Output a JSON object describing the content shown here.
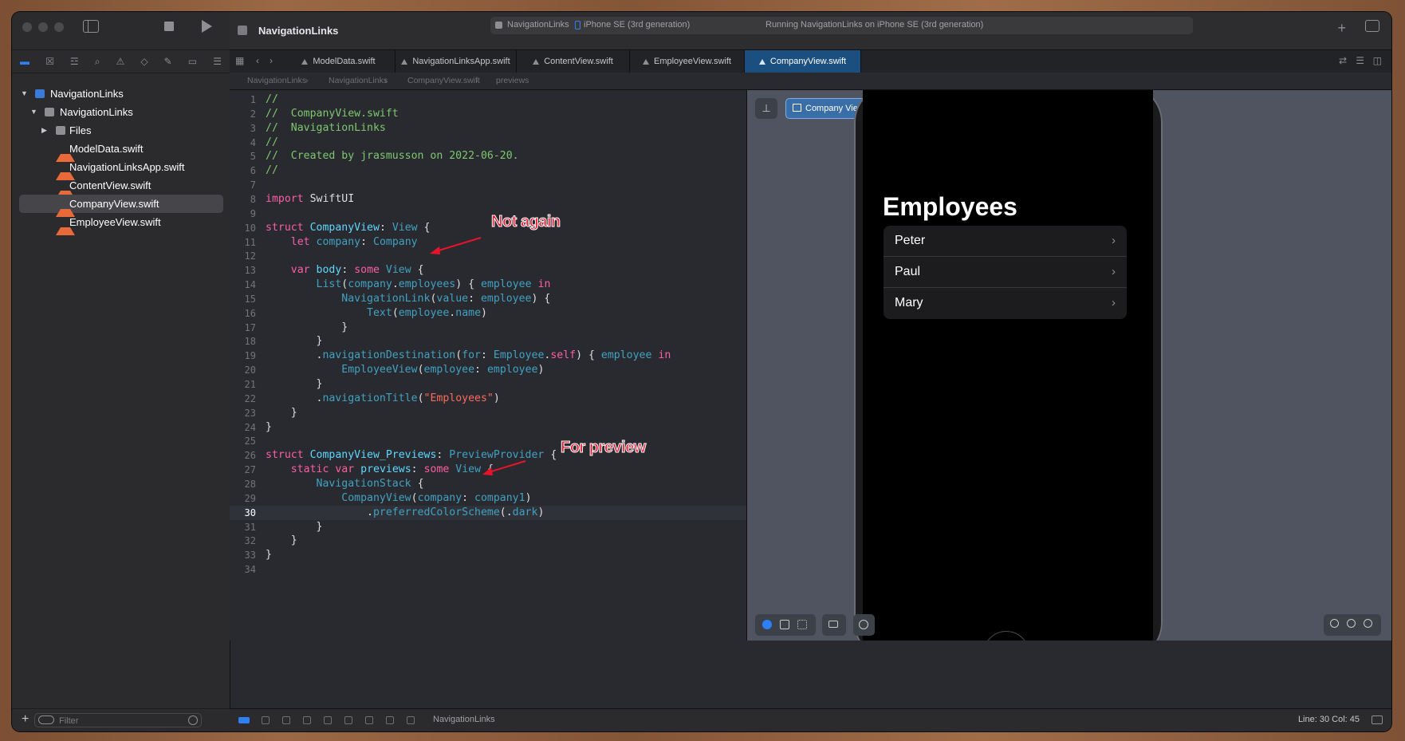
{
  "window": {
    "project_name": "NavigationLinks",
    "scheme": "NavigationLinks",
    "device": "iPhone SE (3rd generation)",
    "run_status": "Running NavigationLinks on iPhone SE (3rd generation)"
  },
  "sidebar": {
    "project": "NavigationLinks",
    "group": "NavigationLinks",
    "items": [
      {
        "label": "Files",
        "kind": "folder"
      },
      {
        "label": "ModelData.swift",
        "kind": "swift"
      },
      {
        "label": "NavigationLinksApp.swift",
        "kind": "swift"
      },
      {
        "label": "ContentView.swift",
        "kind": "swift"
      },
      {
        "label": "CompanyView.swift",
        "kind": "swift",
        "selected": true
      },
      {
        "label": "EmployeeView.swift",
        "kind": "swift"
      }
    ],
    "filter_placeholder": "Filter"
  },
  "tabs": [
    {
      "label": "ModelData.swift"
    },
    {
      "label": "NavigationLinksApp.swift"
    },
    {
      "label": "ContentView.swift"
    },
    {
      "label": "EmployeeView.swift"
    },
    {
      "label": "CompanyView.swift",
      "active": true
    }
  ],
  "jumpbar": {
    "crumbs": [
      "NavigationLinks",
      "NavigationLinks",
      "CompanyView.swift",
      "previews"
    ]
  },
  "editor": {
    "current_line": 30,
    "lines": [
      {
        "n": "1",
        "tokens": [
          [
            "cm",
            "//"
          ]
        ]
      },
      {
        "n": "2",
        "tokens": [
          [
            "cm",
            "//  CompanyView.swift"
          ]
        ]
      },
      {
        "n": "3",
        "tokens": [
          [
            "cm",
            "//  NavigationLinks"
          ]
        ]
      },
      {
        "n": "4",
        "tokens": [
          [
            "cm",
            "//"
          ]
        ]
      },
      {
        "n": "5",
        "tokens": [
          [
            "cm",
            "//  Created by jrasmusson on 2022-06-20."
          ]
        ]
      },
      {
        "n": "6",
        "tokens": [
          [
            "cm",
            "//"
          ]
        ]
      },
      {
        "n": "7",
        "tokens": []
      },
      {
        "n": "8",
        "tokens": [
          [
            "kw",
            "import"
          ],
          [
            "pl",
            " SwiftUI"
          ]
        ]
      },
      {
        "n": "9",
        "tokens": []
      },
      {
        "n": "10",
        "tokens": [
          [
            "kw",
            "struct"
          ],
          [
            "pl",
            " "
          ],
          [
            "ty",
            "CompanyView"
          ],
          [
            "pl",
            ": "
          ],
          [
            "fn",
            "View"
          ],
          [
            "pl",
            " {"
          ]
        ]
      },
      {
        "n": "11",
        "tokens": [
          [
            "pl",
            "    "
          ],
          [
            "kw",
            "let"
          ],
          [
            "pl",
            " "
          ],
          [
            "fn",
            "company"
          ],
          [
            "pl",
            ": "
          ],
          [
            "fn",
            "Company"
          ]
        ]
      },
      {
        "n": "12",
        "tokens": []
      },
      {
        "n": "13",
        "tokens": [
          [
            "pl",
            "    "
          ],
          [
            "kw",
            "var"
          ],
          [
            "pl",
            " "
          ],
          [
            "ty",
            "body"
          ],
          [
            "pl",
            ": "
          ],
          [
            "kw",
            "some"
          ],
          [
            "pl",
            " "
          ],
          [
            "fn",
            "View"
          ],
          [
            "pl",
            " {"
          ]
        ]
      },
      {
        "n": "14",
        "tokens": [
          [
            "pl",
            "        "
          ],
          [
            "fn",
            "List"
          ],
          [
            "pl",
            "("
          ],
          [
            "fn",
            "company"
          ],
          [
            "pl",
            "."
          ],
          [
            "fn",
            "employees"
          ],
          [
            "pl",
            ") { "
          ],
          [
            "fn",
            "employee"
          ],
          [
            "pl",
            " "
          ],
          [
            "kw",
            "in"
          ]
        ]
      },
      {
        "n": "15",
        "tokens": [
          [
            "pl",
            "            "
          ],
          [
            "fn",
            "NavigationLink"
          ],
          [
            "pl",
            "("
          ],
          [
            "fn",
            "value"
          ],
          [
            "pl",
            ": "
          ],
          [
            "fn",
            "employee"
          ],
          [
            "pl",
            ") {"
          ]
        ]
      },
      {
        "n": "16",
        "tokens": [
          [
            "pl",
            "                "
          ],
          [
            "fn",
            "Text"
          ],
          [
            "pl",
            "("
          ],
          [
            "fn",
            "employee"
          ],
          [
            "pl",
            "."
          ],
          [
            "fn",
            "name"
          ],
          [
            "pl",
            ")"
          ]
        ]
      },
      {
        "n": "17",
        "tokens": [
          [
            "pl",
            "            }"
          ]
        ]
      },
      {
        "n": "18",
        "tokens": [
          [
            "pl",
            "        }"
          ]
        ]
      },
      {
        "n": "19",
        "tokens": [
          [
            "pl",
            "        ."
          ],
          [
            "fn",
            "navigationDestination"
          ],
          [
            "pl",
            "("
          ],
          [
            "fn",
            "for"
          ],
          [
            "pl",
            ": "
          ],
          [
            "fn",
            "Employee"
          ],
          [
            "pl",
            "."
          ],
          [
            "kw",
            "self"
          ],
          [
            "pl",
            ") { "
          ],
          [
            "fn",
            "employee"
          ],
          [
            "pl",
            " "
          ],
          [
            "kw",
            "in"
          ]
        ]
      },
      {
        "n": "20",
        "tokens": [
          [
            "pl",
            "            "
          ],
          [
            "fn",
            "EmployeeView"
          ],
          [
            "pl",
            "("
          ],
          [
            "fn",
            "employee"
          ],
          [
            "pl",
            ": "
          ],
          [
            "fn",
            "employee"
          ],
          [
            "pl",
            ")"
          ]
        ]
      },
      {
        "n": "21",
        "tokens": [
          [
            "pl",
            "        }"
          ]
        ]
      },
      {
        "n": "22",
        "tokens": [
          [
            "pl",
            "        ."
          ],
          [
            "fn",
            "navigationTitle"
          ],
          [
            "pl",
            "("
          ],
          [
            "st",
            "\"Employees\""
          ],
          [
            "pl",
            ")"
          ]
        ]
      },
      {
        "n": "23",
        "tokens": [
          [
            "pl",
            "    }"
          ]
        ]
      },
      {
        "n": "24",
        "tokens": [
          [
            "pl",
            "}"
          ]
        ]
      },
      {
        "n": "25",
        "tokens": []
      },
      {
        "n": "26",
        "tokens": [
          [
            "kw",
            "struct"
          ],
          [
            "pl",
            " "
          ],
          [
            "ty",
            "CompanyView_Previews"
          ],
          [
            "pl",
            ": "
          ],
          [
            "fn",
            "PreviewProvider"
          ],
          [
            "pl",
            " {"
          ]
        ]
      },
      {
        "n": "27",
        "tokens": [
          [
            "pl",
            "    "
          ],
          [
            "kw",
            "static"
          ],
          [
            "pl",
            " "
          ],
          [
            "kw",
            "var"
          ],
          [
            "pl",
            " "
          ],
          [
            "ty",
            "previews"
          ],
          [
            "pl",
            ": "
          ],
          [
            "kw",
            "some"
          ],
          [
            "pl",
            " "
          ],
          [
            "fn",
            "View"
          ],
          [
            "pl",
            " {"
          ]
        ]
      },
      {
        "n": "28",
        "tokens": [
          [
            "pl",
            "        "
          ],
          [
            "fn",
            "NavigationStack"
          ],
          [
            "pl",
            " {"
          ]
        ]
      },
      {
        "n": "29",
        "tokens": [
          [
            "pl",
            "            "
          ],
          [
            "fn",
            "CompanyView"
          ],
          [
            "pl",
            "("
          ],
          [
            "fn",
            "company"
          ],
          [
            "pl",
            ": "
          ],
          [
            "fn",
            "company1"
          ],
          [
            "pl",
            ")"
          ]
        ]
      },
      {
        "n": "30",
        "tokens": [
          [
            "pl",
            "                ."
          ],
          [
            "fn",
            "preferredColorScheme"
          ],
          [
            "pl",
            "(."
          ],
          [
            "fn",
            "dark"
          ],
          [
            "pl",
            ")"
          ]
        ]
      },
      {
        "n": "31",
        "tokens": [
          [
            "pl",
            "        }"
          ]
        ]
      },
      {
        "n": "32",
        "tokens": [
          [
            "pl",
            "    }"
          ]
        ]
      },
      {
        "n": "33",
        "tokens": [
          [
            "pl",
            "}"
          ]
        ]
      },
      {
        "n": "34",
        "tokens": []
      }
    ],
    "annotations": {
      "not_again": "Not again",
      "for_preview": "For preview"
    }
  },
  "preview": {
    "chip_label": "Company View",
    "nav_title": "Employees",
    "employees": [
      {
        "name": "Peter"
      },
      {
        "name": "Paul"
      },
      {
        "name": "Mary"
      }
    ]
  },
  "status": {
    "scheme": "NavigationLinks",
    "position": "Line: 30  Col: 45"
  },
  "colors": {
    "comment": "#7ec86e",
    "keyword": "#fc5fa3",
    "type_decl": "#5dd8ff",
    "identifier": "#41a1c0",
    "string": "#fc6a5d",
    "accent": "#2f7ff7",
    "annotation": "#e8132a"
  }
}
